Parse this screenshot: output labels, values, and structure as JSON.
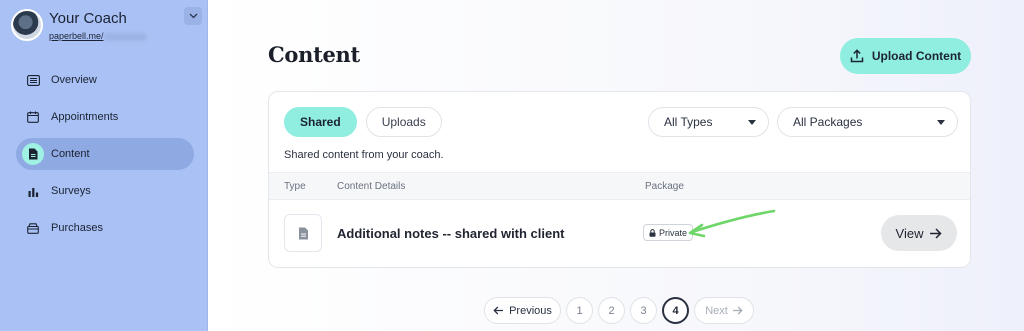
{
  "brand": {
    "name": "Your Coach",
    "url": "paperbell.me/"
  },
  "sidebar": {
    "items": [
      {
        "label": "Overview",
        "icon": "list-icon",
        "active": false
      },
      {
        "label": "Appointments",
        "icon": "calendar-icon",
        "active": false
      },
      {
        "label": "Content",
        "icon": "document-icon",
        "active": true
      },
      {
        "label": "Surveys",
        "icon": "bar-chart-icon",
        "active": false
      },
      {
        "label": "Purchases",
        "icon": "box-icon",
        "active": false
      }
    ]
  },
  "main": {
    "title": "Content",
    "upload_label": "Upload Content",
    "tabs": [
      {
        "label": "Shared",
        "active": true
      },
      {
        "label": "Uploads",
        "active": false
      }
    ],
    "filters": {
      "type": "All Types",
      "package": "All Packages"
    },
    "description": "Shared content from your coach.",
    "columns": {
      "type": "Type",
      "details": "Content Details",
      "package": "Package"
    },
    "rows": [
      {
        "title": "Additional notes -- shared with client",
        "package": "Private",
        "action": "View"
      }
    ]
  },
  "pagination": {
    "previous": "Previous",
    "pages": [
      "1",
      "2",
      "3",
      "4"
    ],
    "current": "4",
    "next": "Next"
  },
  "colors": {
    "accent": "#8feee0",
    "sidebar": "#a9c1f4",
    "annotation_arrow": "#6fd66a"
  }
}
